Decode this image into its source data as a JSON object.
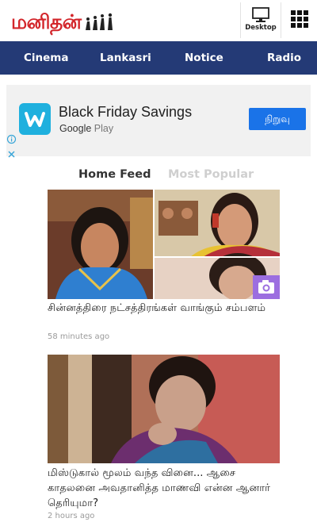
{
  "header": {
    "logo_text": "மனிதன்",
    "desktop_label": "Desktop"
  },
  "nav": {
    "items": [
      {
        "label": "Cinema"
      },
      {
        "label": "Lankasri"
      },
      {
        "label": "Notice"
      },
      {
        "label": "Radio"
      }
    ],
    "background": "#243a76"
  },
  "ad": {
    "title": "Black Friday Savings",
    "subtitle_brand": "Google",
    "subtitle_product": "Play",
    "button_label": "நிறுவு"
  },
  "tabs": [
    {
      "label": "Home Feed",
      "active": true
    },
    {
      "label": "Most Popular",
      "active": false
    }
  ],
  "articles": [
    {
      "title": "சின்னத்திரை நட்சத்திரங்கள் வாங்கும் சம்பளம்",
      "time": "58 minutes ago",
      "has_camera_badge": true
    },
    {
      "title": "மிஸ்டுகால் மூலம் வந்த வினை... ஆசை காதலனை அவதானித்த மாணவி என்ன ஆனார் தெரியுமா?",
      "time": "2 hours ago",
      "has_camera_badge": false
    }
  ],
  "colors": {
    "brand_red": "#d3262b",
    "nav_blue": "#243a76",
    "ad_button": "#1a73e8",
    "camera_badge": "#9c6ee0"
  }
}
